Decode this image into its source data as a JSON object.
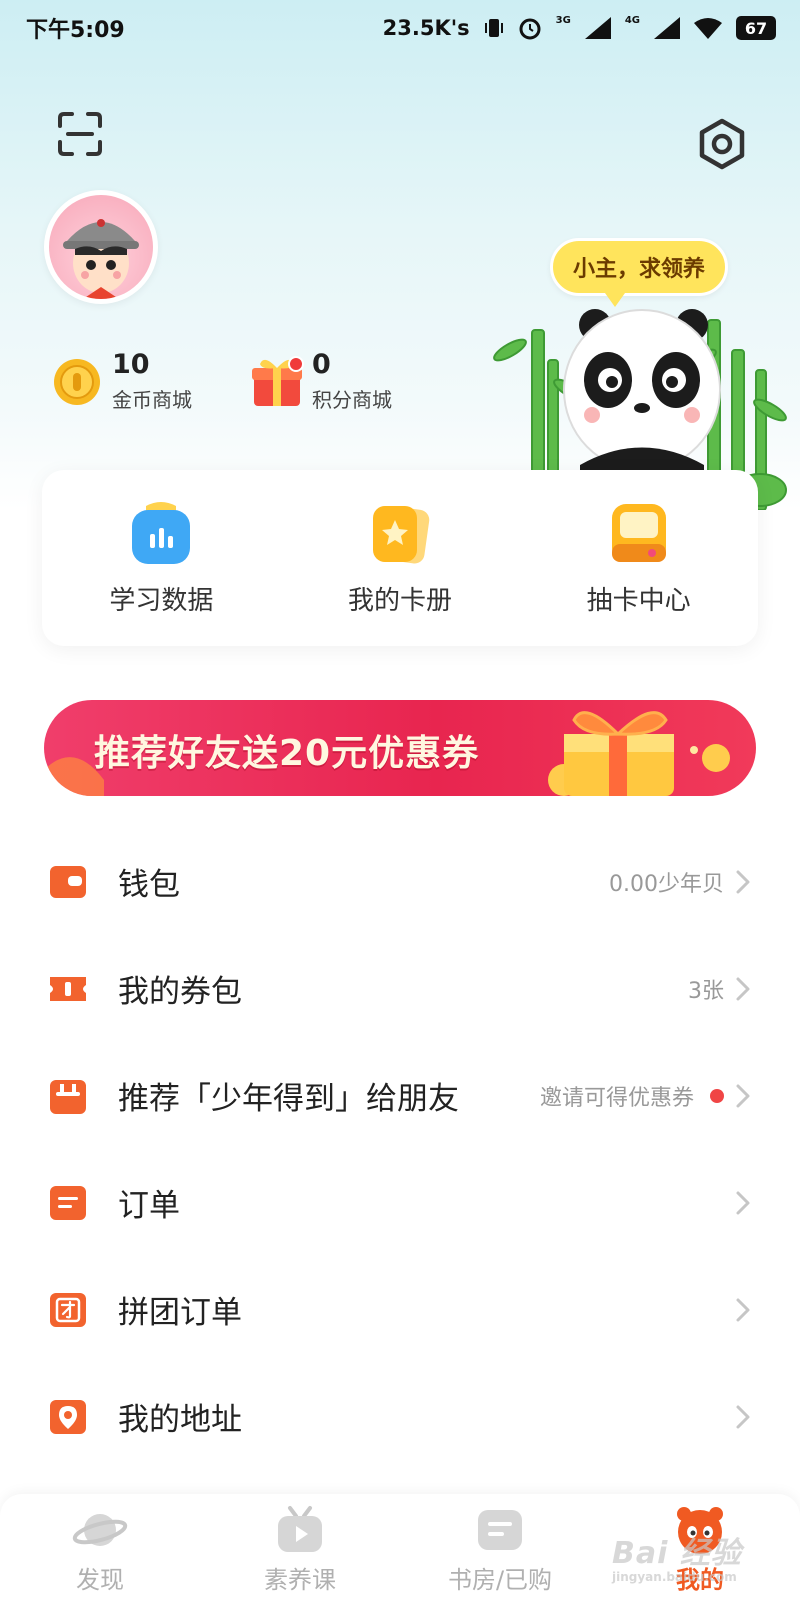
{
  "status_bar": {
    "time": "下午5:09",
    "net_speed": "23.5K's",
    "net_3g": "3G",
    "net_4g": "4G",
    "battery": "67"
  },
  "header": {
    "stats": [
      {
        "value": "10",
        "label": "金币商城"
      },
      {
        "value": "0",
        "label": "积分商城"
      }
    ],
    "speech_bubble": "小主，求领养"
  },
  "quick_actions": [
    {
      "label": "学习数据",
      "icon": "bar-chart-icon"
    },
    {
      "label": "我的卡册",
      "icon": "card-album-icon"
    },
    {
      "label": "抽卡中心",
      "icon": "card-machine-icon"
    }
  ],
  "banner": {
    "text": "推荐好友送20元优惠券"
  },
  "menu": [
    {
      "label": "钱包",
      "value": "0.00少年贝",
      "icon": "wallet-icon"
    },
    {
      "label": "我的券包",
      "value": "3张",
      "icon": "coupon-icon"
    },
    {
      "label": "推荐「少年得到」给朋友",
      "value": "邀请可得优惠券",
      "icon": "gift-box-icon",
      "dot": true
    },
    {
      "label": "订单",
      "value": "",
      "icon": "order-icon"
    },
    {
      "label": "拼团订单",
      "value": "",
      "icon": "group-order-icon"
    },
    {
      "label": "我的地址",
      "value": "",
      "icon": "location-icon"
    }
  ],
  "tabbar": [
    {
      "label": "发现",
      "icon": "planet-icon",
      "active": false
    },
    {
      "label": "素养课",
      "icon": "tv-icon",
      "active": false
    },
    {
      "label": "书房/已购",
      "icon": "book-icon",
      "active": false
    },
    {
      "label": "我的",
      "icon": "panda-icon",
      "active": true
    }
  ],
  "watermark": {
    "main": "Bai 经验",
    "sub": "jingyan.baidu.com"
  },
  "colors": {
    "accent": "#f05a22",
    "banner": "#e8254f",
    "bubble": "#ffe45c"
  }
}
